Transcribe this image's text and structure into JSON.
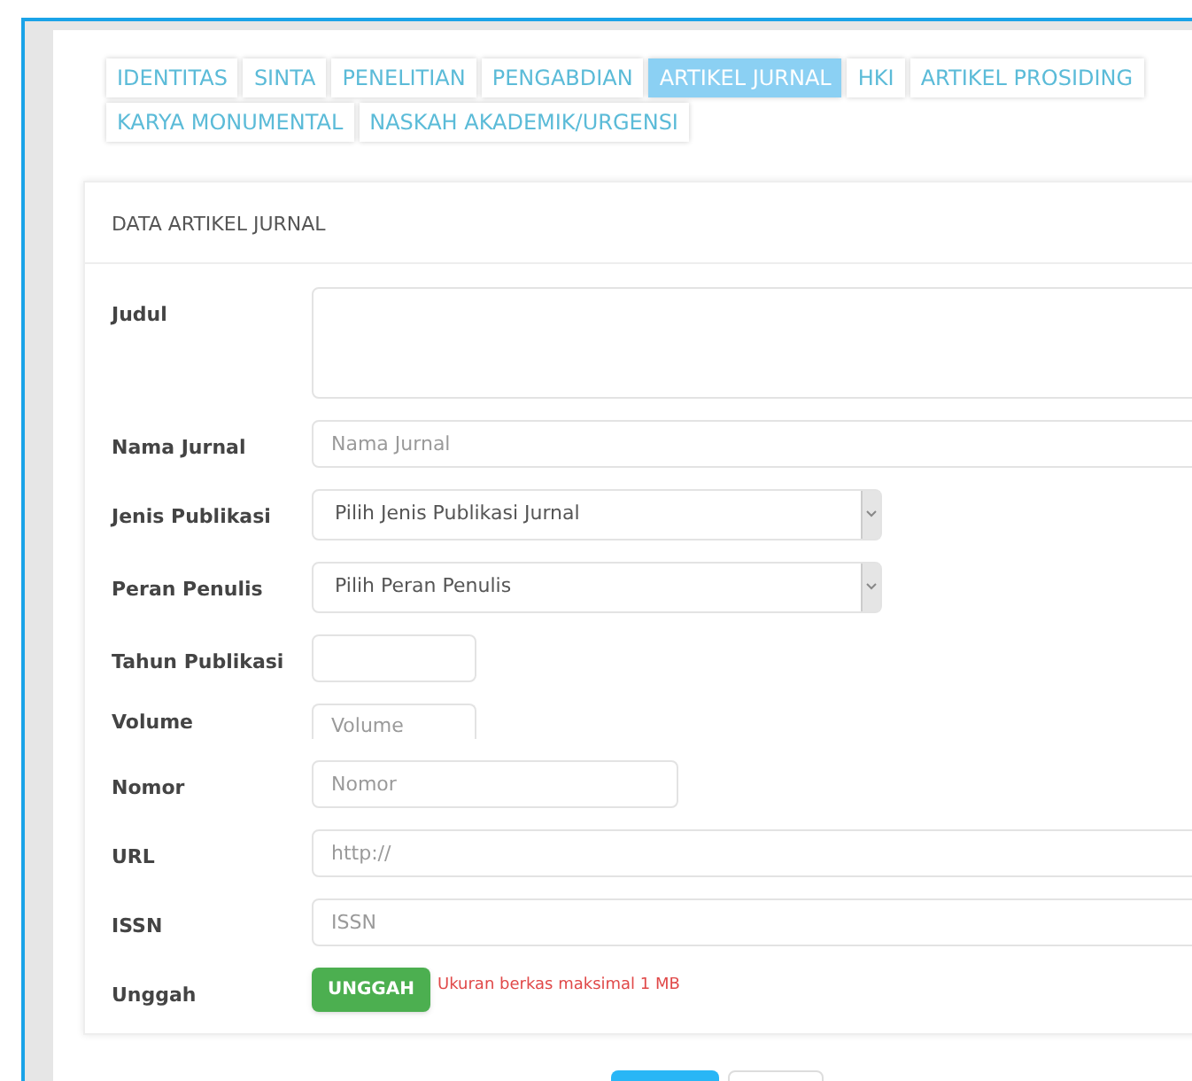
{
  "tabs": [
    {
      "label": "IDENTITAS",
      "selected": false
    },
    {
      "label": "SINTA",
      "selected": false
    },
    {
      "label": "PENELITIAN",
      "selected": false
    },
    {
      "label": "PENGABDIAN",
      "selected": false
    },
    {
      "label": "ARTIKEL JURNAL",
      "selected": true
    },
    {
      "label": "HKI",
      "selected": false
    },
    {
      "label": "ARTIKEL PROSIDING",
      "selected": false
    },
    {
      "label": "KARYA MONUMENTAL",
      "selected": false
    },
    {
      "label": "NASKAH AKADEMIK/URGENSI",
      "selected": false
    }
  ],
  "card": {
    "title": "DATA ARTIKEL JURNAL",
    "fields": [
      {
        "label": "Judul",
        "kind": "textarea"
      },
      {
        "label": "Nama Jurnal",
        "kind": "text",
        "placeholder": "Nama Jurnal"
      },
      {
        "label": "Jenis Publikasi",
        "kind": "select",
        "value": "Pilih Jenis Publikasi Jurnal"
      },
      {
        "label": "Peran Penulis",
        "kind": "select",
        "value": "Pilih Peran Penulis"
      },
      {
        "label": "Tahun Publikasi",
        "kind": "year"
      },
      {
        "label": "Volume",
        "kind": "cut",
        "placeholder": "Volume"
      },
      {
        "label": "Nomor",
        "kind": "number",
        "placeholder": "Nomor"
      },
      {
        "label": "URL",
        "kind": "text",
        "placeholder": "http://"
      },
      {
        "label": "ISSN",
        "kind": "text",
        "placeholder": "ISSN"
      },
      {
        "label": "Unggah",
        "kind": "upload",
        "button": "UNGGAH",
        "note": "Ukuran berkas maksimal 1 MB"
      }
    ]
  }
}
